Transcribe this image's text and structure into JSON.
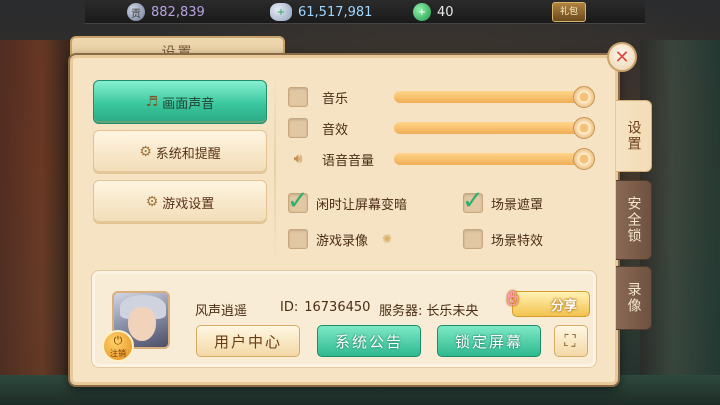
{
  "topbar": {
    "coin": {
      "icon": "coin-icon",
      "value": "882,839",
      "glyph": "贡"
    },
    "silver": {
      "icon": "silver-ingot-icon",
      "value": "61,517,981"
    },
    "gem": {
      "icon": "green-gem-icon",
      "value": "40"
    },
    "gift": {
      "icon": "gift-icon",
      "label": "礼包"
    }
  },
  "dialog": {
    "title": "设置",
    "menu": [
      {
        "label": "画面声音",
        "icon": "music-note-icon",
        "active": true
      },
      {
        "label": "系统和提醒",
        "icon": "gear-icon",
        "active": false
      },
      {
        "label": "游戏设置",
        "icon": "gear-icon",
        "active": false
      }
    ],
    "sliders": [
      {
        "label": "音乐",
        "checked": false,
        "level": 1.0
      },
      {
        "label": "音效",
        "checked": false,
        "level": 1.0
      },
      {
        "label": "语音音量",
        "icon": "speaker-icon",
        "level": 1.0
      }
    ],
    "options": [
      {
        "label": "闲时让屏幕变暗",
        "checked": true
      },
      {
        "label": "场景遮罩",
        "checked": true
      },
      {
        "label": "游戏录像",
        "checked": false
      },
      {
        "label": "场景特效",
        "checked": false
      }
    ],
    "profile": {
      "name": "风声逍遥",
      "id_label": "ID:",
      "id_value": "16736450",
      "server_label": "服务器:",
      "server_value": "长乐未央",
      "logout_label": "注销",
      "share_label": "分享",
      "buttons": {
        "user_center": "用户中心",
        "notice": "系统公告",
        "lock_screen": "锁定屏幕"
      }
    },
    "side_tabs": [
      {
        "label": "设置",
        "active": true
      },
      {
        "label": "安全锁",
        "active": false
      },
      {
        "label": "录像",
        "active": false
      }
    ]
  }
}
